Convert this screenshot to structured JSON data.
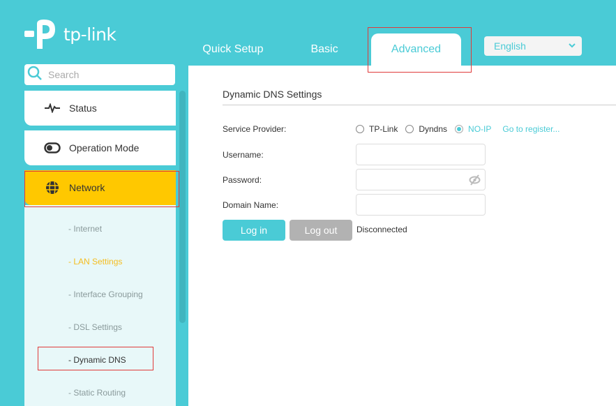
{
  "brand": {
    "name": "tp-link"
  },
  "tabs": [
    {
      "label": "Quick Setup",
      "active": false
    },
    {
      "label": "Basic",
      "active": false
    },
    {
      "label": "Advanced",
      "active": true
    }
  ],
  "language": {
    "selected": "English"
  },
  "search": {
    "placeholder": "Search",
    "value": ""
  },
  "sidebar": {
    "items": [
      {
        "label": "Status",
        "icon": "pulse-icon",
        "active": false
      },
      {
        "label": "Operation Mode",
        "icon": "toggle-icon",
        "active": false
      },
      {
        "label": "Network",
        "icon": "globe-icon",
        "active": true
      }
    ],
    "subitems": [
      {
        "label": "- Internet",
        "state": "normal"
      },
      {
        "label": "- LAN Settings",
        "state": "highlighted"
      },
      {
        "label": "- Interface Grouping",
        "state": "normal"
      },
      {
        "label": "- DSL Settings",
        "state": "normal"
      },
      {
        "label": "- Dynamic DNS",
        "state": "current"
      },
      {
        "label": "- Static Routing",
        "state": "normal"
      }
    ]
  },
  "main": {
    "title": "Dynamic DNS Settings",
    "service_provider": {
      "label": "Service Provider:",
      "options": [
        "TP-Link",
        "Dyndns",
        "NO-IP"
      ],
      "selected": "NO-IP",
      "register_link": "Go to register..."
    },
    "username": {
      "label": "Username:",
      "value": ""
    },
    "password": {
      "label": "Password:",
      "value": ""
    },
    "domain": {
      "label": "Domain Name:",
      "value": ""
    },
    "login_label": "Log in",
    "logout_label": "Log out",
    "status": "Disconnected"
  },
  "colors": {
    "accent": "#4acbd6",
    "active_menu": "#ffc800",
    "active_sub": "#f5bd1f",
    "disabled_button": "#b2b2b2"
  }
}
